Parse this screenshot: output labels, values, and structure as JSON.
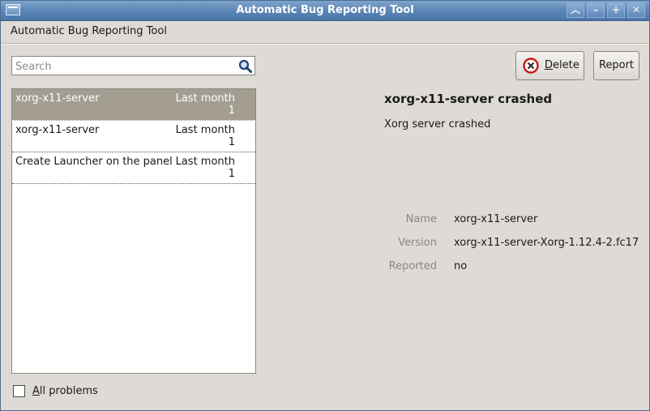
{
  "window": {
    "title": "Automatic Bug Reporting Tool",
    "controls": [
      "roll-up",
      "minimize",
      "maximize",
      "close"
    ]
  },
  "app": {
    "title": "Automatic Bug Reporting Tool"
  },
  "search": {
    "placeholder": "Search",
    "value": ""
  },
  "problems": [
    {
      "name": "xorg-x11-server",
      "when": "Last month",
      "count": "1",
      "selected": true
    },
    {
      "name": "xorg-x11-server",
      "when": "Last month",
      "count": "1",
      "selected": false
    },
    {
      "name": "Create Launcher on the panel",
      "when": "Last month",
      "count": "1",
      "selected": false
    }
  ],
  "filter": {
    "all_problems_label_u": "A",
    "all_problems_label_rest": "ll problems",
    "checked": false
  },
  "toolbar": {
    "delete_label": "Delete",
    "report_label": "Report"
  },
  "detail": {
    "title": "xorg-x11-server crashed",
    "description": "Xorg server crashed",
    "fields": {
      "name_key": "Name",
      "name_value": "xorg-x11-server",
      "version_key": "Version",
      "version_value": "xorg-x11-server-Xorg-1.12.4-2.fc17",
      "reported_key": "Reported",
      "reported_value": "no"
    }
  },
  "icons": {
    "search": "search-icon",
    "delete": "delete-icon"
  },
  "colors": {
    "titlebar": "#5c86b6",
    "selection": "#a49d91",
    "window_bg": "#dedbd6"
  }
}
